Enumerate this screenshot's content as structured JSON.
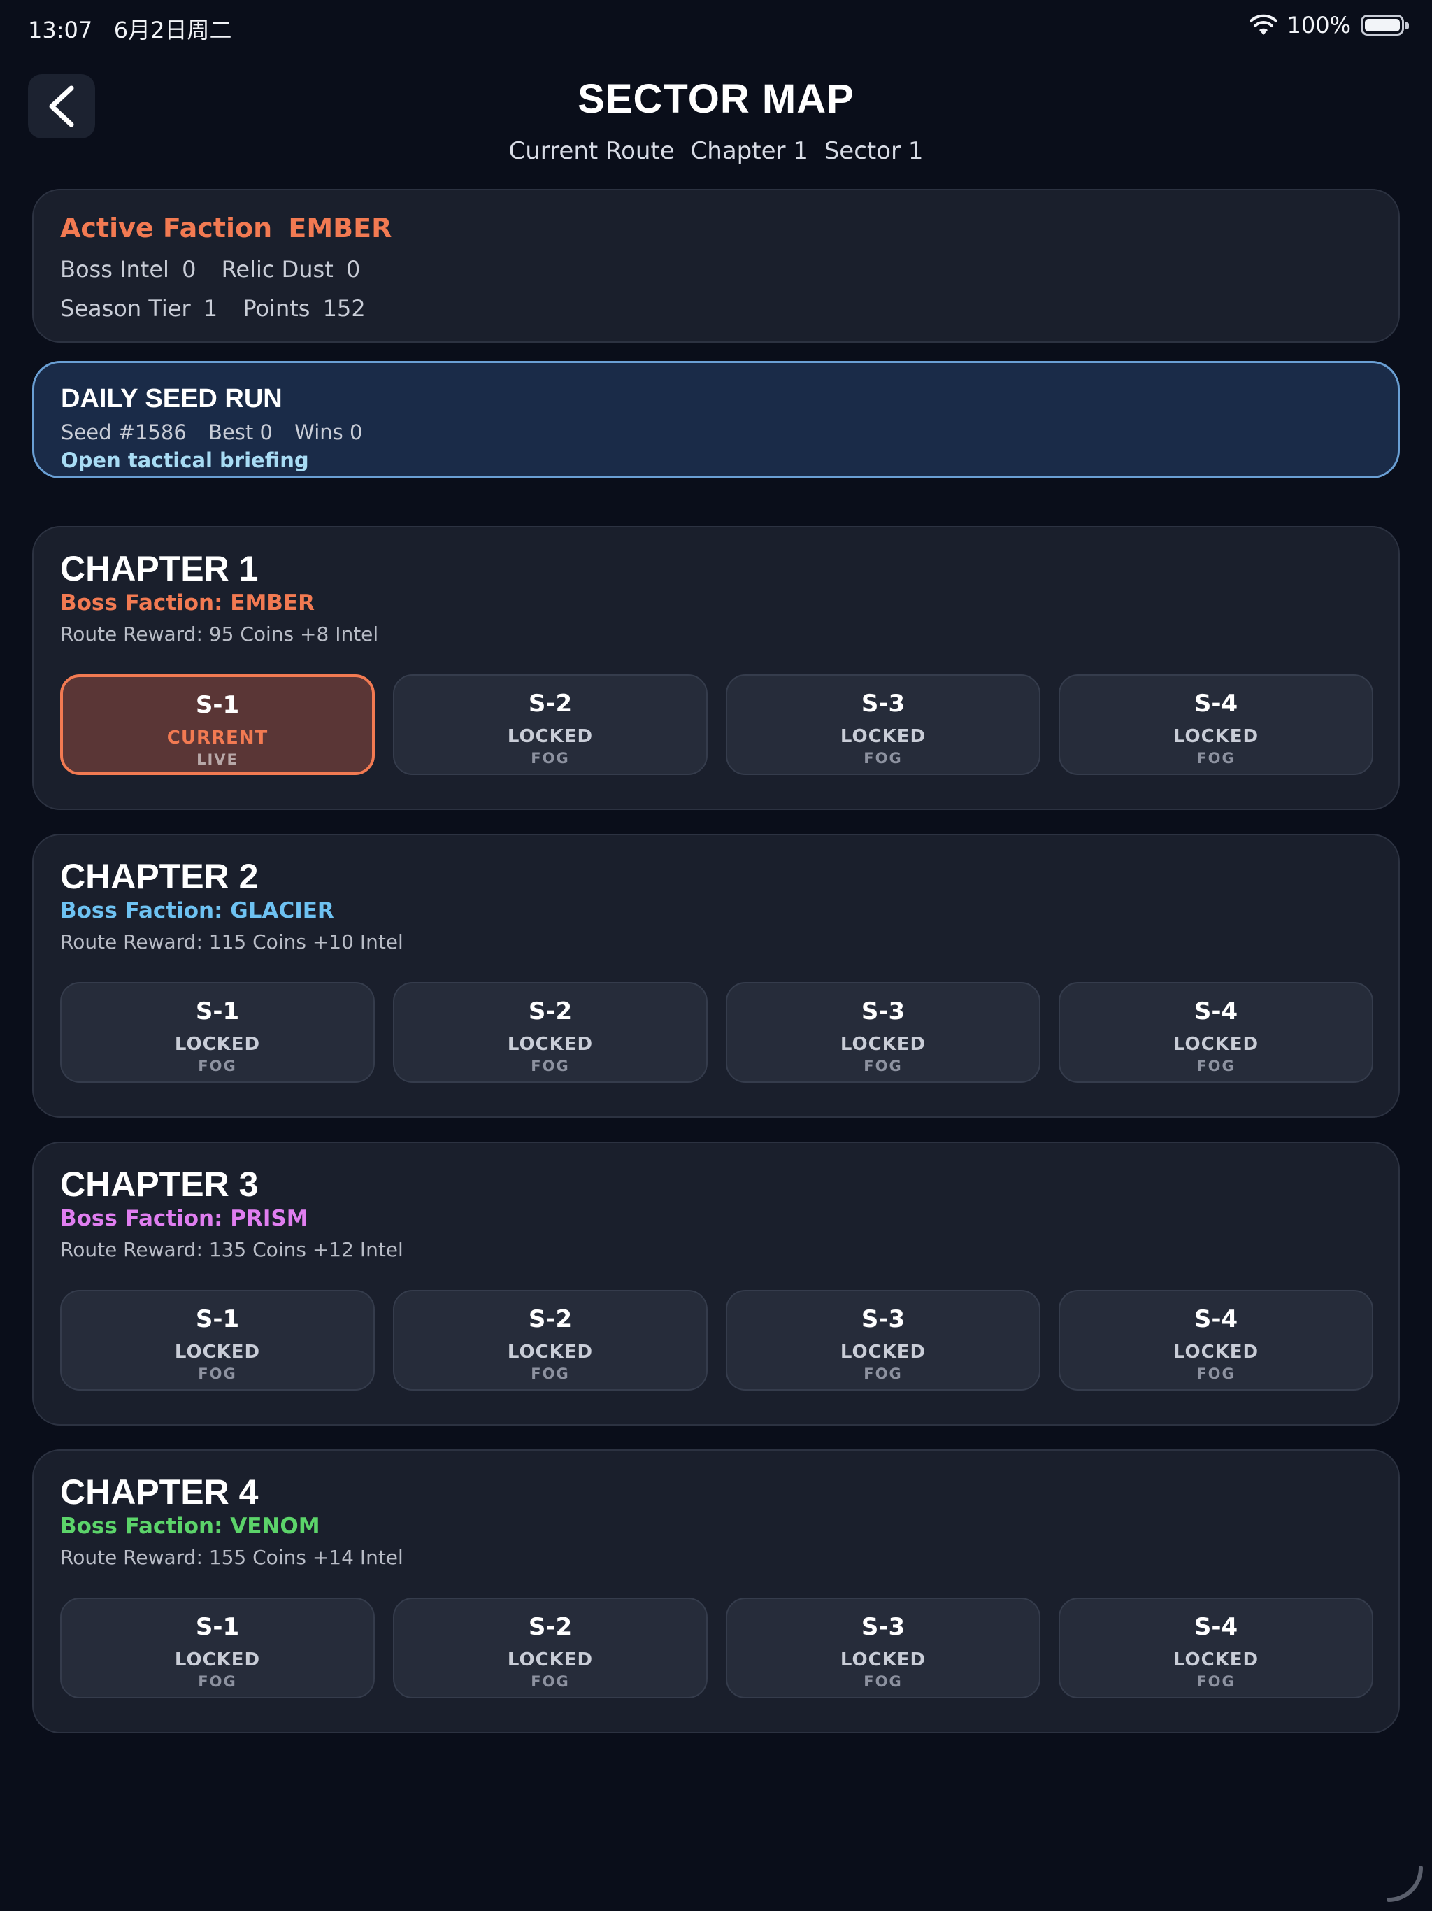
{
  "status_bar": {
    "time": "13:07",
    "date": "6月2日周二",
    "battery_percent": "100%",
    "battery_level": 1.0,
    "wifi_icon": "wifi-icon",
    "battery_icon": "battery-icon"
  },
  "header": {
    "back_icon": "chevron-left-icon",
    "title": "SECTOR MAP",
    "route_label": "Current Route",
    "route_chapter": "Chapter 1",
    "route_sector": "Sector 1"
  },
  "faction": {
    "label": "Active Faction",
    "name": "EMBER",
    "boss_intel_label": "Boss Intel",
    "boss_intel_value": "0",
    "relic_dust_label": "Relic Dust",
    "relic_dust_value": "0",
    "season_tier_label": "Season Tier",
    "season_tier_value": "1",
    "points_label": "Points",
    "points_value": "152"
  },
  "daily": {
    "title": "DAILY SEED RUN",
    "seed": "Seed #1586",
    "best": "Best 0",
    "wins": "Wins 0",
    "link": "Open tactical briefing"
  },
  "colors": {
    "ember": "#f27a52",
    "glacier": "#6ec2f2",
    "prism": "#e07ef0",
    "venom": "#5cd46a"
  },
  "chapters": [
    {
      "title": "CHAPTER 1",
      "boss": "Boss Faction: EMBER",
      "boss_color": "#f27a52",
      "reward": "Route Reward: 95 Coins  +8 Intel",
      "sectors": [
        {
          "name": "S-1",
          "state": "CURRENT",
          "sub": "LIVE",
          "current": true
        },
        {
          "name": "S-2",
          "state": "LOCKED",
          "sub": "FOG",
          "current": false
        },
        {
          "name": "S-3",
          "state": "LOCKED",
          "sub": "FOG",
          "current": false
        },
        {
          "name": "S-4",
          "state": "LOCKED",
          "sub": "FOG",
          "current": false
        }
      ]
    },
    {
      "title": "CHAPTER 2",
      "boss": "Boss Faction: GLACIER",
      "boss_color": "#6ec2f2",
      "reward": "Route Reward: 115 Coins  +10 Intel",
      "sectors": [
        {
          "name": "S-1",
          "state": "LOCKED",
          "sub": "FOG",
          "current": false
        },
        {
          "name": "S-2",
          "state": "LOCKED",
          "sub": "FOG",
          "current": false
        },
        {
          "name": "S-3",
          "state": "LOCKED",
          "sub": "FOG",
          "current": false
        },
        {
          "name": "S-4",
          "state": "LOCKED",
          "sub": "FOG",
          "current": false
        }
      ]
    },
    {
      "title": "CHAPTER 3",
      "boss": "Boss Faction: PRISM",
      "boss_color": "#e07ef0",
      "reward": "Route Reward: 135 Coins  +12 Intel",
      "sectors": [
        {
          "name": "S-1",
          "state": "LOCKED",
          "sub": "FOG",
          "current": false
        },
        {
          "name": "S-2",
          "state": "LOCKED",
          "sub": "FOG",
          "current": false
        },
        {
          "name": "S-3",
          "state": "LOCKED",
          "sub": "FOG",
          "current": false
        },
        {
          "name": "S-4",
          "state": "LOCKED",
          "sub": "FOG",
          "current": false
        }
      ]
    },
    {
      "title": "CHAPTER 4",
      "boss": "Boss Faction: VENOM",
      "boss_color": "#5cd46a",
      "reward": "Route Reward: 155 Coins  +14 Intel",
      "sectors": [
        {
          "name": "S-1",
          "state": "LOCKED",
          "sub": "FOG",
          "current": false
        },
        {
          "name": "S-2",
          "state": "LOCKED",
          "sub": "FOG",
          "current": false
        },
        {
          "name": "S-3",
          "state": "LOCKED",
          "sub": "FOG",
          "current": false
        },
        {
          "name": "S-4",
          "state": "LOCKED",
          "sub": "FOG",
          "current": false
        }
      ]
    }
  ]
}
